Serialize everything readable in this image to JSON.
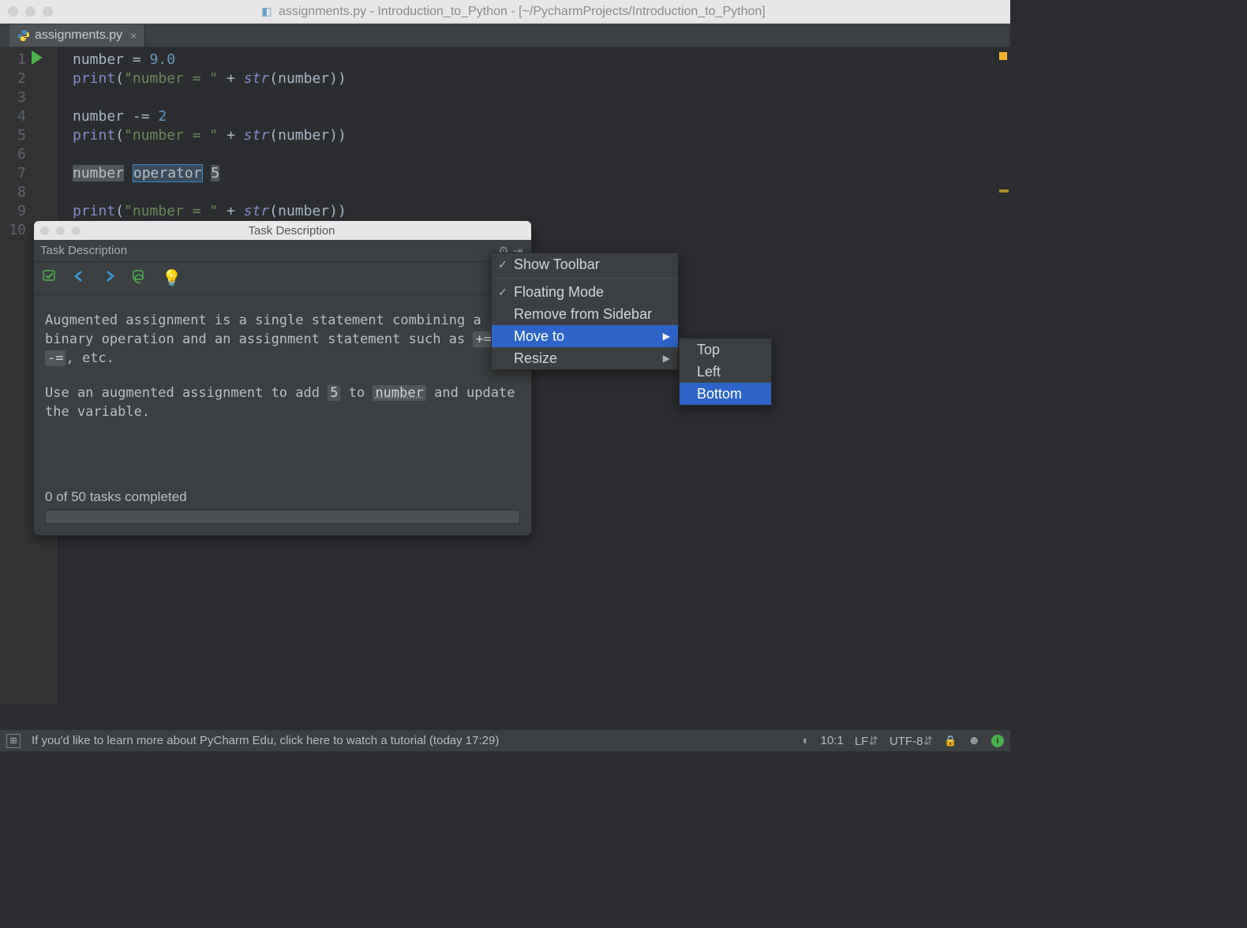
{
  "window": {
    "title": "assignments.py - Introduction_to_Python - [~/PycharmProjects/Introduction_to_Python]"
  },
  "tabs": [
    {
      "label": "assignments.py"
    }
  ],
  "editor": {
    "line_numbers": [
      "1",
      "2",
      "3",
      "4",
      "5",
      "6",
      "7",
      "8",
      "9",
      "10"
    ],
    "lines": {
      "l1_id": "number",
      "l1_eq": " = ",
      "l1_num": "9.0",
      "l2_fn": "print",
      "l2_open": "(",
      "l2_str": "\"number = \"",
      "l2_plus": " + ",
      "l2_built": "str",
      "l2_inner": "(number))",
      "l4_id": "number",
      "l4_op": " -= ",
      "l4_num": "2",
      "l7_id": "number",
      "l7_ph1": "operator",
      "l7_ph2": "5"
    }
  },
  "task_panel": {
    "window_title": "Task Description",
    "header": "Task Description",
    "body_p1a": "Augmented assignment is a single statement combining a binary operation and an assignment statement such as ",
    "body_p1_code1": "+=",
    "body_p1_mid": ", ",
    "body_p1_code2": "-=",
    "body_p1_end": ", etc.",
    "body_p2a": "Use an augmented assignment to add ",
    "body_p2_code1": "5",
    "body_p2_mid": " to ",
    "body_p2_code2": "number",
    "body_p2_end": " and update the variable.",
    "progress_text": "0 of 50 tasks completed"
  },
  "context_menu": {
    "show_toolbar": "Show Toolbar",
    "floating_mode": "Floating Mode",
    "remove_sidebar": "Remove from Sidebar",
    "move_to": "Move to",
    "resize": "Resize"
  },
  "submenu": {
    "top": "Top",
    "left": "Left",
    "bottom": "Bottom"
  },
  "statusbar": {
    "tip": "If you'd like to learn more about PyCharm Edu, click here to watch a tutorial (today 17:29)",
    "caret": "10:1",
    "line_sep": "LF",
    "encoding": "UTF-8"
  },
  "icons": {
    "gear": "⚙",
    "hide": "⇥",
    "check_task": "✓",
    "prev": "⬅",
    "next": "➡",
    "reset": "↩",
    "hint": "💡",
    "sub_arrow": "▶",
    "checkmark": "✓",
    "lf_arrows": "⇵",
    "lock": "🔒",
    "man": "☺"
  }
}
